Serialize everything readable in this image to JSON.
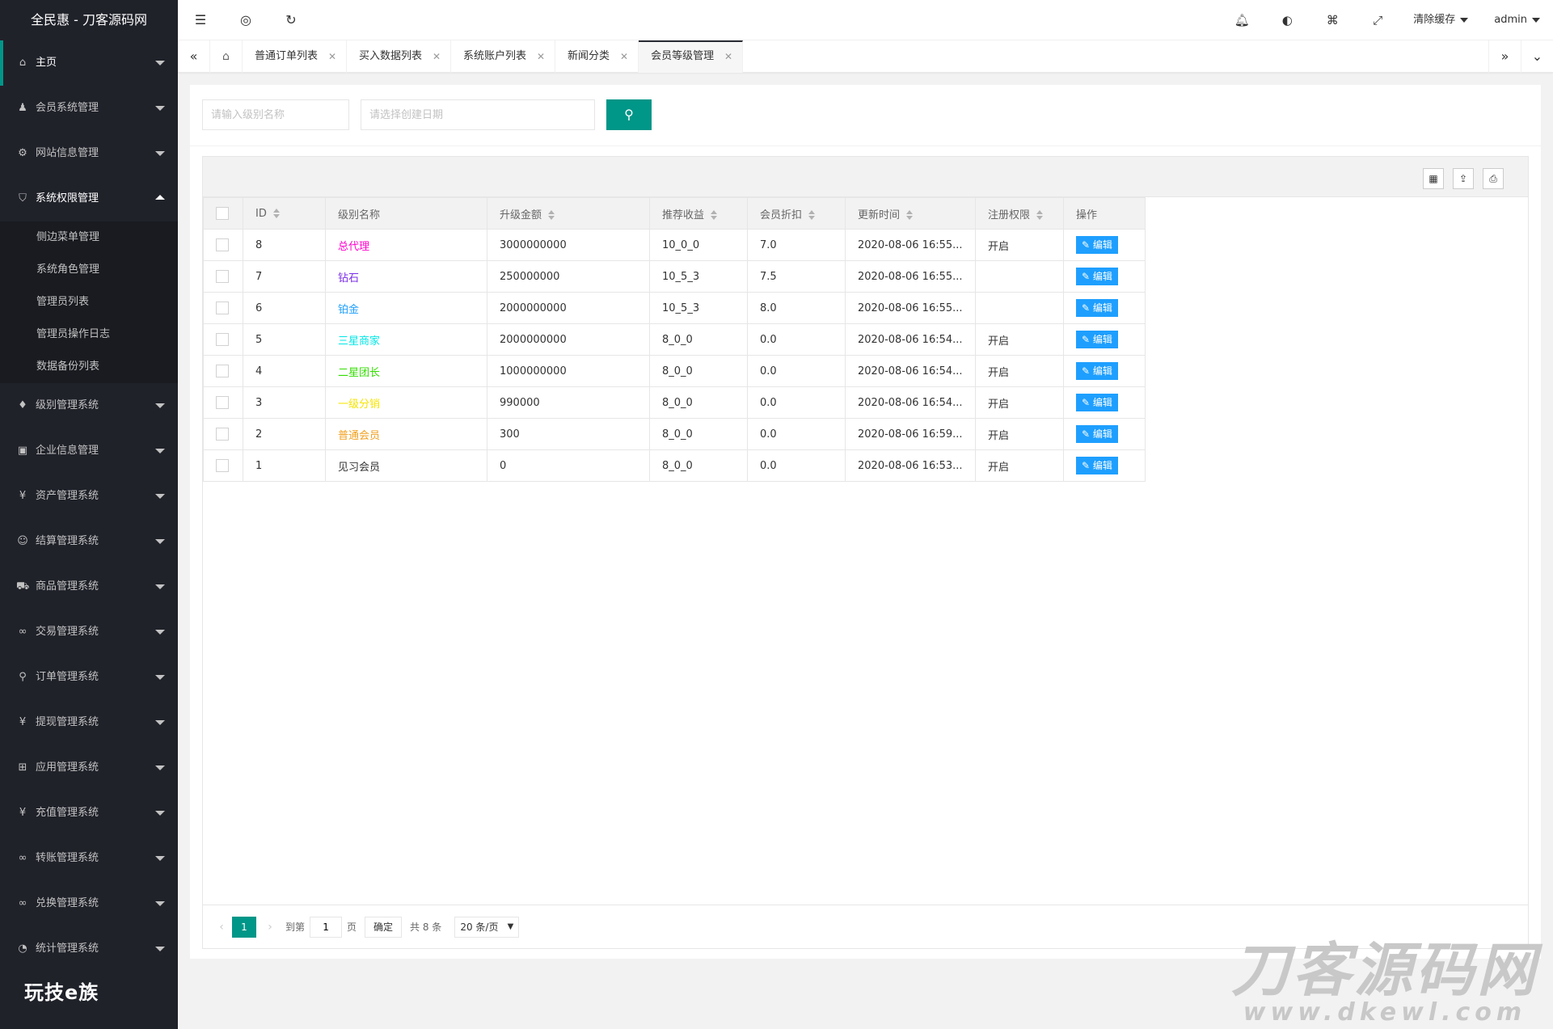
{
  "sidebar": {
    "logo": "全民惠 - 刀客源码网",
    "items": [
      {
        "icon": "⌂",
        "label": "主页"
      },
      {
        "icon": "♟",
        "label": "会员系统管理"
      },
      {
        "icon": "⚙",
        "label": "网站信息管理"
      },
      {
        "icon": "⛉",
        "label": "系统权限管理"
      },
      {
        "icon": "♦",
        "label": "级别管理系统"
      },
      {
        "icon": "▣",
        "label": "企业信息管理"
      },
      {
        "icon": "¥",
        "label": "资产管理系统"
      },
      {
        "icon": "☺",
        "label": "结算管理系统"
      },
      {
        "icon": "⛟",
        "label": "商品管理系统"
      },
      {
        "icon": "∞",
        "label": "交易管理系统"
      },
      {
        "icon": "⚲",
        "label": "订单管理系统"
      },
      {
        "icon": "¥",
        "label": "提现管理系统"
      },
      {
        "icon": "⊞",
        "label": "应用管理系统"
      },
      {
        "icon": "¥",
        "label": "充值管理系统"
      },
      {
        "icon": "∞",
        "label": "转账管理系统"
      },
      {
        "icon": "∞",
        "label": "兑换管理系统"
      },
      {
        "icon": "◔",
        "label": "统计管理系统"
      }
    ],
    "sub_items": [
      "侧边菜单管理",
      "系统角色管理",
      "管理员列表",
      "管理员操作日志",
      "数据备份列表"
    ],
    "brand": "玩技e族"
  },
  "header": {
    "clear_cache": "清除缓存",
    "user": "admin"
  },
  "tabs": [
    "普通订单列表",
    "买入数据列表",
    "系统账户列表",
    "新闻分类",
    "会员等级管理"
  ],
  "search": {
    "level_placeholder": "请输入级别名称",
    "date_placeholder": "请选择创建日期"
  },
  "table": {
    "columns": [
      "ID",
      "级别名称",
      "升级金额",
      "推荐收益",
      "会员折扣",
      "更新时间",
      "注册权限",
      "操作"
    ],
    "edit_label": "编辑",
    "rows": [
      {
        "id": "8",
        "name": "总代理",
        "color": "#ff00cc",
        "amount": "3000000000",
        "reward": "10_0_0",
        "discount": "7.0",
        "time": "2020-08-06 16:55...",
        "perm": "开启"
      },
      {
        "id": "7",
        "name": "钻石",
        "color": "#7b2fe6",
        "amount": "250000000",
        "reward": "10_5_3",
        "discount": "7.5",
        "time": "2020-08-06 16:55...",
        "perm": ""
      },
      {
        "id": "6",
        "name": "铂金",
        "color": "#1e9fff",
        "amount": "2000000000",
        "reward": "10_5_3",
        "discount": "8.0",
        "time": "2020-08-06 16:55...",
        "perm": ""
      },
      {
        "id": "5",
        "name": "三星商家",
        "color": "#00e5e5",
        "amount": "2000000000",
        "reward": "8_0_0",
        "discount": "0.0",
        "time": "2020-08-06 16:54...",
        "perm": "开启"
      },
      {
        "id": "4",
        "name": "二星团长",
        "color": "#33dd00",
        "amount": "1000000000",
        "reward": "8_0_0",
        "discount": "0.0",
        "time": "2020-08-06 16:54...",
        "perm": "开启"
      },
      {
        "id": "3",
        "name": "一级分销",
        "color": "#f5e400",
        "amount": "990000",
        "reward": "8_0_0",
        "discount": "0.0",
        "time": "2020-08-06 16:54...",
        "perm": "开启"
      },
      {
        "id": "2",
        "name": "普通会员",
        "color": "#f0a020",
        "amount": "300",
        "reward": "8_0_0",
        "discount": "0.0",
        "time": "2020-08-06 16:59...",
        "perm": "开启"
      },
      {
        "id": "1",
        "name": "见习会员",
        "color": "#333333",
        "amount": "0",
        "reward": "8_0_0",
        "discount": "0.0",
        "time": "2020-08-06 16:53...",
        "perm": "开启"
      }
    ]
  },
  "pager": {
    "current": "1",
    "goto_label": "到第",
    "page_value": "1",
    "page_unit": "页",
    "confirm": "确定",
    "total": "共 8 条",
    "per_page": "20 条/页"
  },
  "watermark": {
    "line1": "刀客源码网",
    "line2": "www.dkewl.com"
  },
  "colors": {
    "sidebar_bg": "#20222a",
    "accent": "#009688",
    "edit_button": "#1e9fff"
  }
}
